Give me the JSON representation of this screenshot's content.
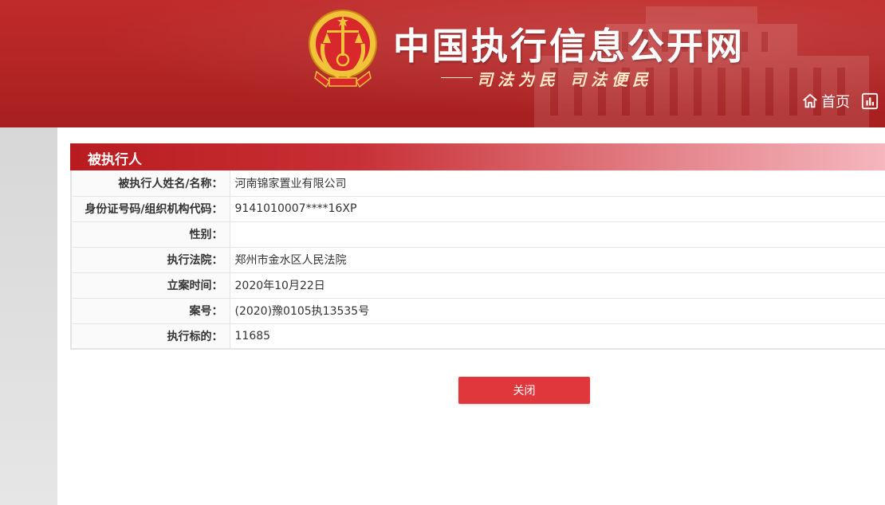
{
  "header": {
    "site_title": "中国执行信息公开网",
    "slogan": "司法为民  司法便民",
    "nav": {
      "home_label": "首页"
    }
  },
  "section": {
    "title": "被执行人"
  },
  "details": [
    {
      "label": "被执行人姓名/名称：",
      "value": "河南锦家置业有限公司"
    },
    {
      "label": "身份证号码/组织机构代码：",
      "value": "9141010007****16XP"
    },
    {
      "label": "性别：",
      "value": ""
    },
    {
      "label": "执行法院：",
      "value": "郑州市金水区人民法院"
    },
    {
      "label": "立案时间：",
      "value": "2020年10月22日"
    },
    {
      "label": "案号：",
      "value": "(2020)豫0105执13535号"
    },
    {
      "label": "执行标的：",
      "value": "11685"
    }
  ],
  "actions": {
    "close_label": "关闭"
  },
  "colors": {
    "header_red": "#b32525",
    "accent_red": "#e0373c",
    "slogan_cream": "#fde9c8"
  },
  "icons": {
    "emblem": "national-court-emblem",
    "home": "home-icon",
    "stats": "stats-icon"
  }
}
